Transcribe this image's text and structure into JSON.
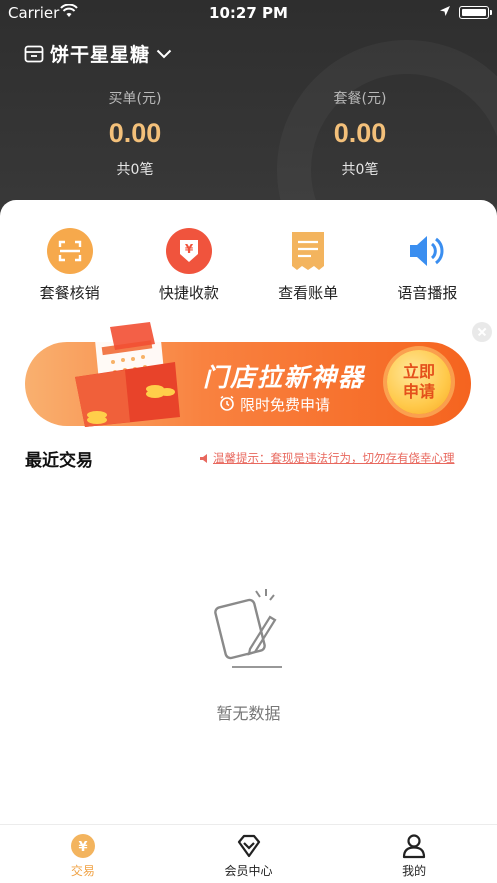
{
  "status_bar": {
    "carrier": "Carrier",
    "time": "10:27 PM"
  },
  "header": {
    "store_name": "饼干星星糖",
    "stats": [
      {
        "label": "买单(元)",
        "value": "0.00",
        "count": "共0笔"
      },
      {
        "label": "套餐(元)",
        "value": "0.00",
        "count": "共0笔"
      }
    ]
  },
  "actions": [
    {
      "label": "套餐核销",
      "icon": "scan-icon"
    },
    {
      "label": "快捷收款",
      "icon": "yen-download-icon"
    },
    {
      "label": "查看账单",
      "icon": "bill-icon"
    },
    {
      "label": "语音播报",
      "icon": "speaker-icon"
    }
  ],
  "banner": {
    "title": "门店拉新神器",
    "subtitle": "限时免费申请",
    "cta_line1": "立即",
    "cta_line2": "申请"
  },
  "recent": {
    "title": "最近交易",
    "tip": "温馨提示：套现是违法行为，切勿存有侥幸心理",
    "empty_text": "暂无数据"
  },
  "tabbar": [
    {
      "label": "交易",
      "active": true
    },
    {
      "label": "会员中心",
      "active": false
    },
    {
      "label": "我的",
      "active": false
    }
  ],
  "colors": {
    "accent": "#f0a346",
    "amount": "#f3c07a",
    "banner_orange": "#f5641f",
    "tip_red": "#e8685e"
  }
}
